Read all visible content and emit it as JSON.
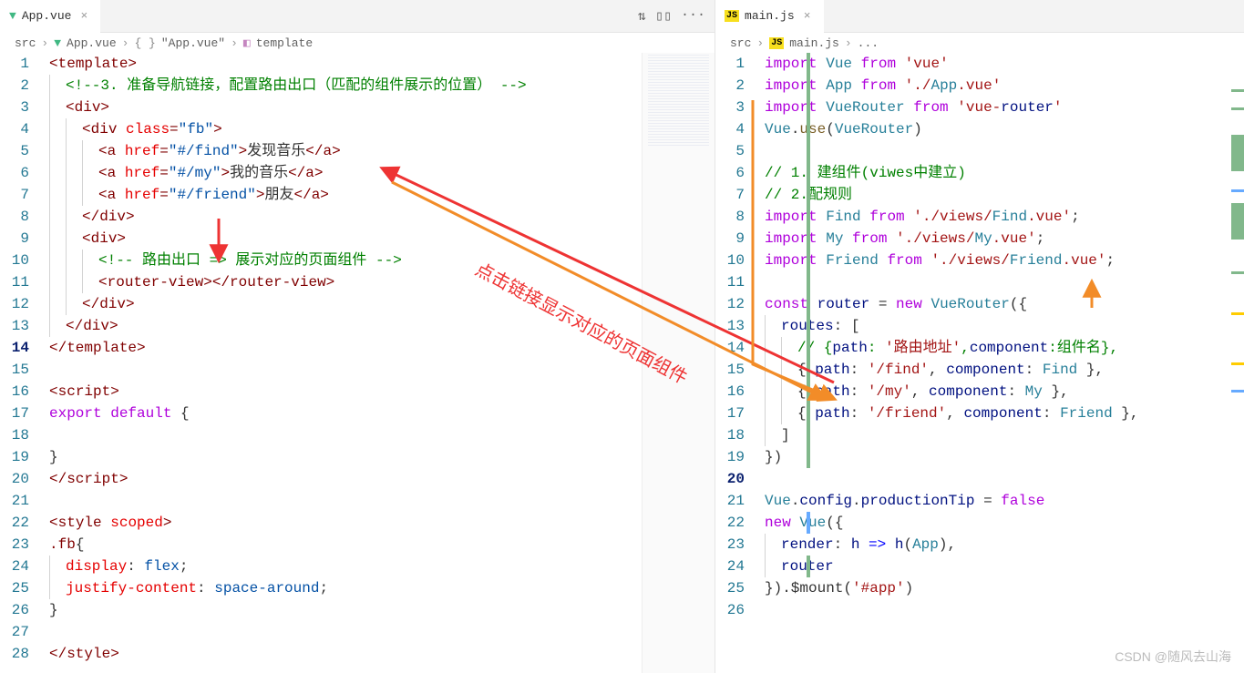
{
  "left": {
    "tab": {
      "file": "App.vue",
      "icon": "vue"
    },
    "breadcrumb": [
      "src",
      "App.vue",
      "\"App.vue\"",
      "template"
    ],
    "lines": [
      "<template>",
      "  <!--3. 准备导航链接，配置路由出口（匹配的组件展示的位置） -->",
      "  <div>",
      "    <div class=\"fb\">",
      "      <a href=\"#/find\">发现音乐</a>",
      "      <a href=\"#/my\">我的音乐</a>",
      "      <a href=\"#/friend\">朋友</a>",
      "    </div>",
      "    <div>",
      "      <!-- 路由出口 => 展示对应的页面组件 -->",
      "      <router-view></router-view>",
      "    </div>",
      "  </div>",
      "</template>",
      "",
      "<script>",
      "export default {",
      "",
      "}",
      "</script>",
      "",
      "<style scoped>",
      ".fb{",
      "  display: flex;",
      "  justify-content: space-around;",
      "}",
      "",
      "</style>"
    ],
    "maxLines": 29
  },
  "right": {
    "tab": {
      "file": "main.js",
      "icon": "js"
    },
    "breadcrumb": [
      "src",
      "main.js",
      "..."
    ],
    "lines": [
      "import Vue from 'vue'",
      "import App from './App.vue'",
      "import VueRouter from 'vue-router'",
      "Vue.use(VueRouter)",
      "",
      "// 1. 建组件(viwes中建立)",
      "// 2.配规则",
      "import Find from './views/Find.vue';",
      "import My from './views/My.vue';",
      "import Friend from './views/Friend.vue';",
      "",
      "const router = new VueRouter({",
      "  routes: [",
      "    // {path: '路由地址',component:组件名},",
      "    { path: '/find', component: Find },",
      "    { path: '/my', component: My },",
      "    { path: '/friend', component: Friend },",
      "  ]",
      "})",
      "",
      "Vue.config.productionTip = false",
      "new Vue({",
      "  render: h => h(App),",
      "  router",
      "}).$mount('#app')",
      ""
    ],
    "maxLines": 26
  },
  "annotation": "点击链接显示对应的页面组件",
  "watermark": "CSDN @随风去山海"
}
